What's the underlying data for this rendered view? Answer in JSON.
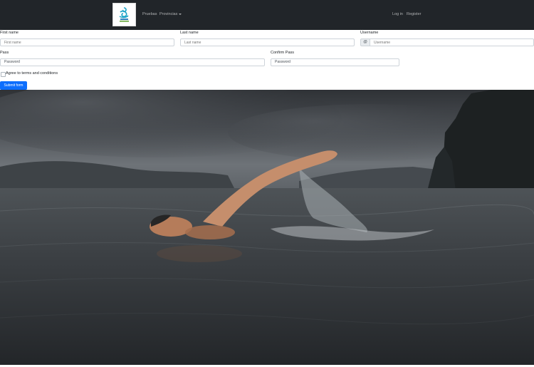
{
  "navbar": {
    "links": [
      "Pruebas",
      "Provincias"
    ],
    "auth": [
      "Log in",
      "Register"
    ]
  },
  "form": {
    "first_name": {
      "label": "First name",
      "placeholder": "First name"
    },
    "last_name": {
      "label": "Last name",
      "placeholder": "Last name"
    },
    "username": {
      "label": "Username",
      "addon": "@",
      "placeholder": "Username"
    },
    "password": {
      "label": "Pass",
      "value": "Password"
    },
    "confirm_password": {
      "label": "Confirm Pass",
      "value": "Password"
    },
    "terms_label": "Agree to terms and conditions",
    "submit_label": "Submit form"
  },
  "hero": {
    "image_icon": "swimmer-photo"
  }
}
